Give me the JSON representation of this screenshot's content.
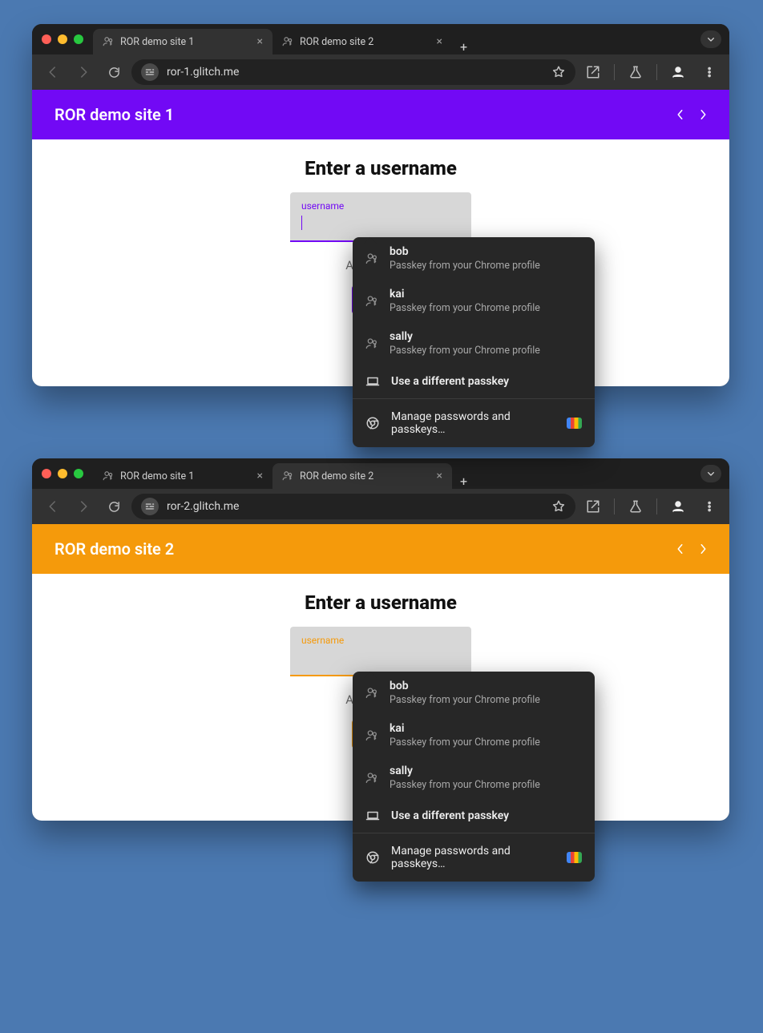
{
  "passkeys": {
    "items": [
      {
        "name": "bob",
        "sub": "Passkey from your Chrome profile"
      },
      {
        "name": "kai",
        "sub": "Passkey from your Chrome profile"
      },
      {
        "name": "sally",
        "sub": "Passkey from your Chrome profile"
      }
    ],
    "different": "Use a different passkey",
    "manage": "Manage passwords and passkeys…"
  },
  "windows": [
    {
      "accent": "#7209f5",
      "url": "ror-1.glitch.me",
      "tabs": [
        {
          "title": "ROR demo site 1",
          "active": true
        },
        {
          "title": "ROR demo site 2",
          "active": false
        }
      ],
      "banner_title": "ROR demo site 1",
      "heading": "Enter a username",
      "field_label": "username",
      "hint": "Any usernam",
      "show_caret": true
    },
    {
      "accent": "#f59a0b",
      "url": "ror-2.glitch.me",
      "tabs": [
        {
          "title": "ROR demo site 1",
          "active": false
        },
        {
          "title": "ROR demo site 2",
          "active": true
        }
      ],
      "banner_title": "ROR demo site 2",
      "heading": "Enter a username",
      "field_label": "username",
      "hint": "Any usernam",
      "show_caret": false
    }
  ]
}
